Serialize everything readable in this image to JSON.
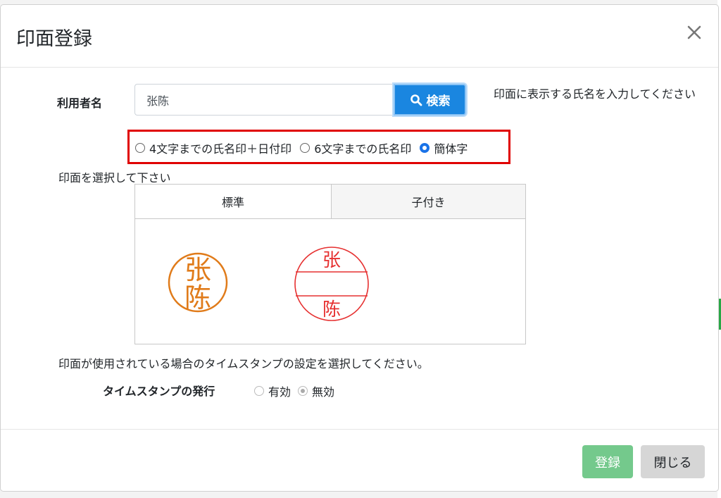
{
  "modal": {
    "title": "印面登録",
    "close_icon": "close-icon"
  },
  "user": {
    "label": "利用者名",
    "input_value": "张陈",
    "search_label": "検索",
    "search_icon": "search-icon",
    "hint": "印面に表示する氏名を入力してください"
  },
  "style_options": [
    {
      "label": "4文字までの氏名印＋日付印",
      "checked": false
    },
    {
      "label": "6文字までの氏名印",
      "checked": false
    },
    {
      "label": "簡体字",
      "checked": true
    }
  ],
  "select_prompt": "印面を選択して下さい",
  "tabs": [
    {
      "label": "標準",
      "active": true
    },
    {
      "label": "子付き",
      "active": false
    }
  ],
  "stamps": {
    "name_stamp": {
      "line1": "张",
      "line2": "陈",
      "color": "#e07b1a"
    },
    "date_stamp": {
      "top": "张",
      "bottom": "陈",
      "color": "#e63030"
    }
  },
  "timestamp": {
    "description": "印面が使用されている場合のタイムスタンプの設定を選択してください。",
    "label": "タイムスタンプの発行",
    "options": [
      {
        "label": "有効",
        "checked": false
      },
      {
        "label": "無効",
        "checked": true
      }
    ]
  },
  "footer": {
    "register_label": "登録",
    "close_label": "閉じる"
  },
  "colors": {
    "primary": "#1a86e0",
    "success": "#74c98c",
    "highlight": "#e00000"
  }
}
